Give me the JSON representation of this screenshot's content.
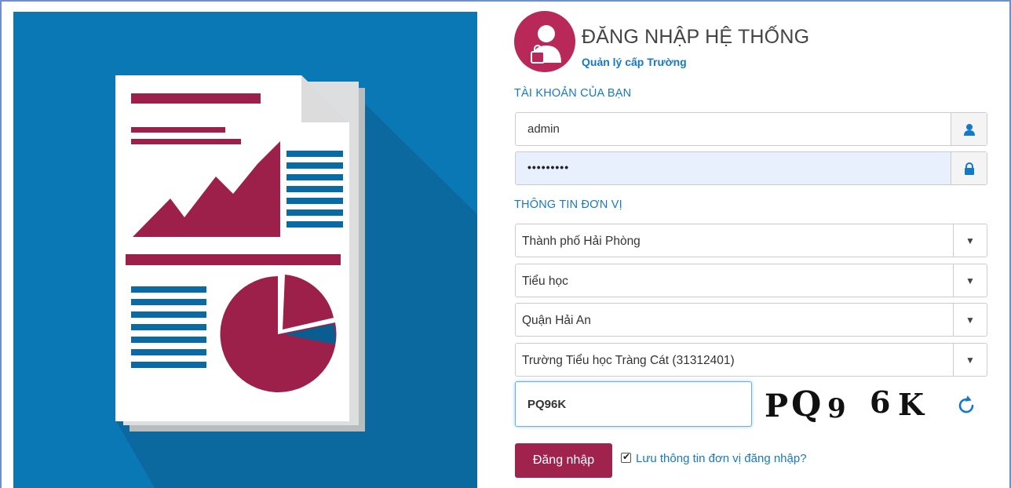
{
  "header": {
    "title": "ĐĂNG NHẬP HỆ THỐNG",
    "subtitle": "Quản lý cấp Trường"
  },
  "account_section": {
    "label": "TÀI KHOẢN CỦA BẠN",
    "username": "admin",
    "password": "•••••••••"
  },
  "unit_section": {
    "label": "THÔNG TIN ĐƠN VỊ",
    "province": "Thành phố Hải Phòng",
    "level": "Tiểu học",
    "district": "Quận Hải An",
    "school": "Trường Tiểu học Tràng Cát (31312401)"
  },
  "captcha": {
    "input_value": "PQ96K",
    "image_chars": [
      "P",
      "Q",
      "9",
      "6",
      "K"
    ]
  },
  "actions": {
    "login_label": "Đăng nhập",
    "remember_label": "Lưu thông tin đơn vị đăng nhập?",
    "remember_checked": true
  },
  "icons": [
    "lock-person-icon",
    "user-icon",
    "lock-icon",
    "caret-down-icon",
    "refresh-icon"
  ],
  "colors": {
    "brand": "#a0234e",
    "link": "#1479c9",
    "illustration_bg": "#0a78b5"
  }
}
